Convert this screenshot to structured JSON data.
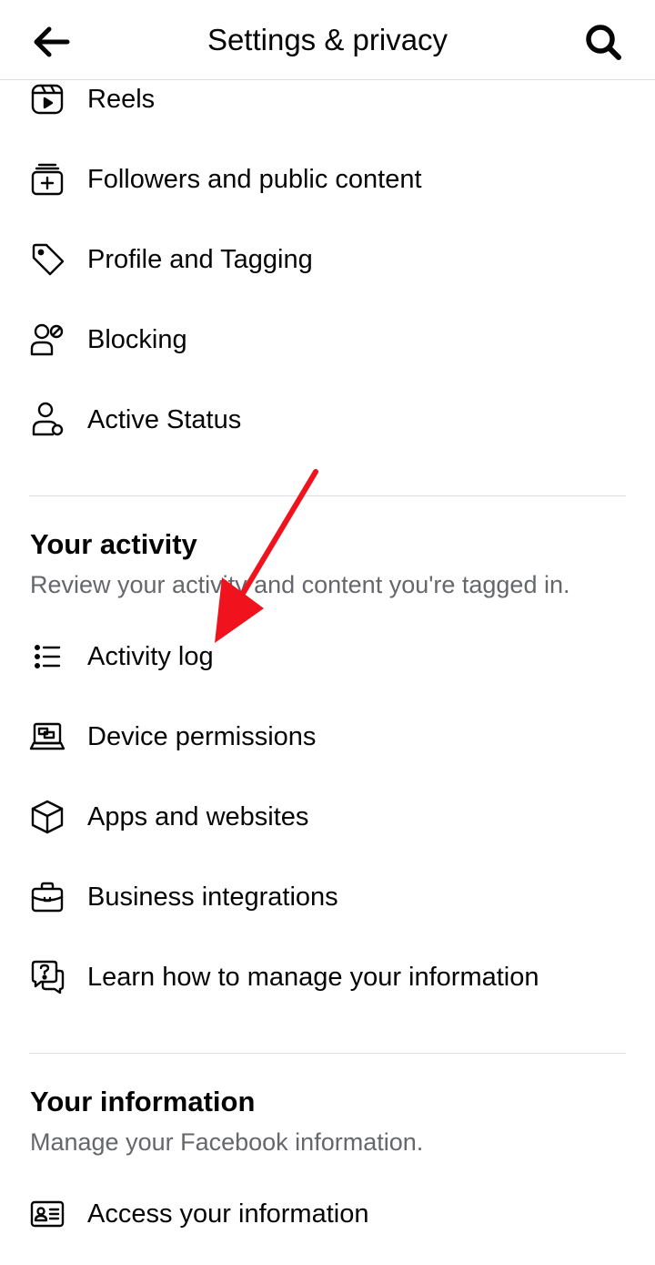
{
  "header": {
    "title": "Settings & privacy"
  },
  "top_items": [
    {
      "label": "Reels",
      "icon": "reels-icon"
    },
    {
      "label": "Followers and public content",
      "icon": "followers-icon"
    },
    {
      "label": "Profile and Tagging",
      "icon": "tag-icon"
    },
    {
      "label": "Blocking",
      "icon": "block-user-icon"
    },
    {
      "label": "Active Status",
      "icon": "active-status-icon"
    }
  ],
  "your_activity": {
    "title": "Your activity",
    "subtitle": "Review your activity and content you're tagged in.",
    "items": [
      {
        "label": "Activity log",
        "icon": "list-icon"
      },
      {
        "label": "Device permissions",
        "icon": "laptop-icon"
      },
      {
        "label": "Apps and websites",
        "icon": "cube-icon"
      },
      {
        "label": "Business integrations",
        "icon": "briefcase-icon"
      },
      {
        "label": "Learn how to manage your information",
        "icon": "question-chat-icon"
      }
    ]
  },
  "your_information": {
    "title": "Your information",
    "subtitle": "Manage your Facebook information.",
    "items": [
      {
        "label": "Access your information",
        "icon": "id-card-icon"
      }
    ]
  },
  "colors": {
    "text": "#050505",
    "secondary_text": "#65676b",
    "divider": "#dadde1",
    "annotation_arrow": "#f0131e"
  }
}
